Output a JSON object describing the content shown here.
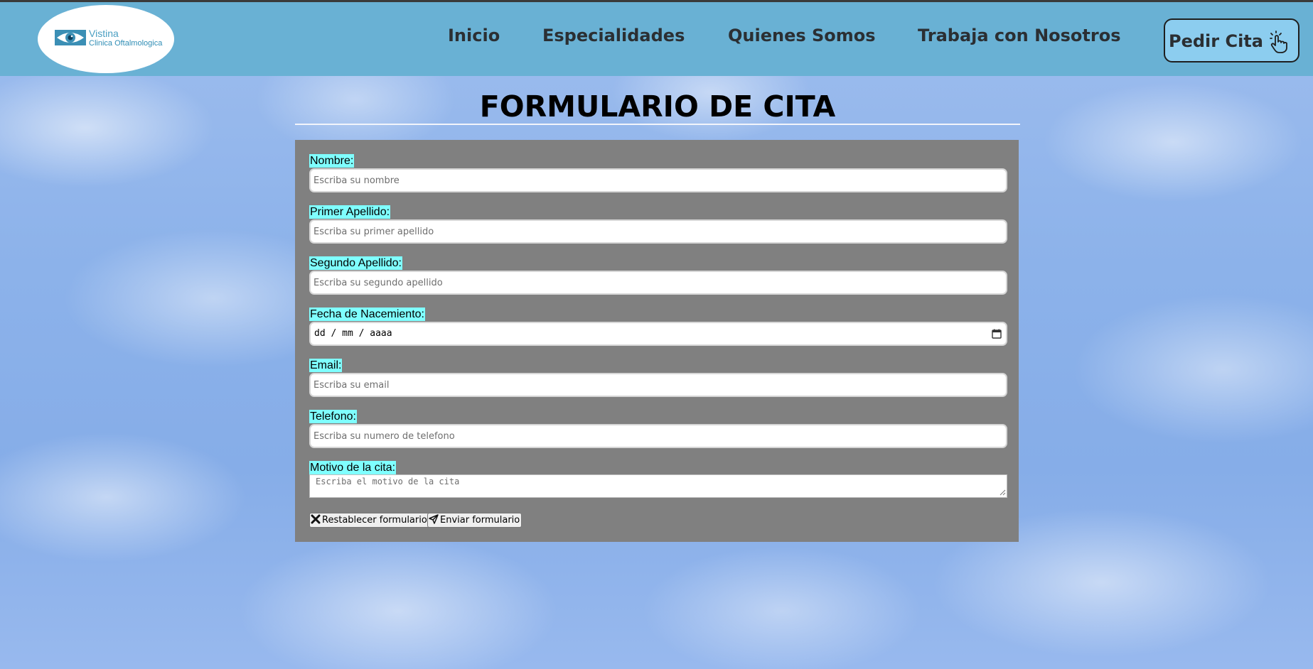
{
  "logo": {
    "name": "Vistina",
    "subtitle": "Clinica Oftalmologica"
  },
  "nav": {
    "items": [
      {
        "label": "Inicio"
      },
      {
        "label": "Especialidades"
      },
      {
        "label": "Quienes Somos"
      },
      {
        "label": "Trabaja con Nosotros"
      }
    ],
    "cta_label": "Pedir Cita",
    "cta_icon": "hand-pointer-icon"
  },
  "page": {
    "title": "FORMULARIO DE CITA"
  },
  "form": {
    "fields": [
      {
        "label": "Nombre:",
        "placeholder": "Escriba su nombre"
      },
      {
        "label": "Primer Apellido:",
        "placeholder": "Escriba su primer apellido"
      },
      {
        "label": "Segundo Apellido:",
        "placeholder": "Escriba su segundo apellido"
      },
      {
        "label": "Fecha de Nacemiento:",
        "value": "dd / mm / aaaa"
      },
      {
        "label": "Email:",
        "placeholder": "Escriba su email"
      },
      {
        "label": "Telefono:",
        "placeholder": "Escriba su numero de telefono"
      },
      {
        "label": "Motivo de la cita:",
        "placeholder": "Escriba el motivo de la cita"
      }
    ],
    "reset_label": "Restablecer formulario",
    "submit_label": "Enviar formulario"
  },
  "colors": {
    "header": "#69b1d4",
    "cta_background": "#8ccdef",
    "label_highlight": "#7fffff",
    "form_panel": "#808080"
  }
}
